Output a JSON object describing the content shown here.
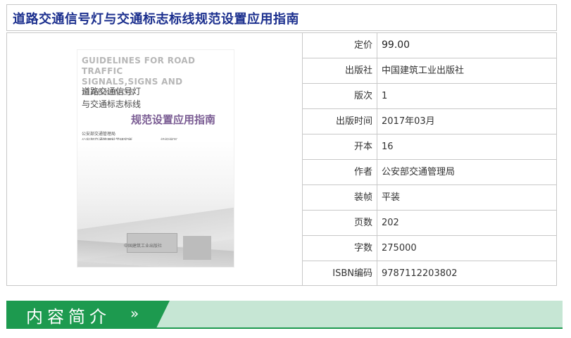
{
  "title": "道路交通信号灯与交通标志标线规范设置应用指南",
  "cover": {
    "en_line1": "GUIDELINES FOR ROAD TRAFFIC",
    "en_line2": "SIGNALS,SIGNS AND MARKINGS",
    "cn_line1": "道路交通信号灯",
    "cn_line2": "与交通标志标线",
    "cn_line3": "规范设置应用指南",
    "pub_line1": "公安部交通管理局",
    "pub_line2": "公安部交通管理科学研究所",
    "pub_line3": "组织编写",
    "foot": "中国建筑工业出版社"
  },
  "details": [
    {
      "label": "定价",
      "value": "99.00"
    },
    {
      "label": "出版社",
      "value": "中国建筑工业出版社"
    },
    {
      "label": "版次",
      "value": "1"
    },
    {
      "label": "出版时间",
      "value": "2017年03月"
    },
    {
      "label": "开本",
      "value": "16"
    },
    {
      "label": "作者",
      "value": "公安部交通管理局"
    },
    {
      "label": "装帧",
      "value": "平装"
    },
    {
      "label": "页数",
      "value": "202"
    },
    {
      "label": "字数",
      "value": "275000"
    },
    {
      "label": "ISBN编码",
      "value": "9787112203802"
    }
  ],
  "section": {
    "label": "内容简介",
    "arrow": "»"
  },
  "colors": {
    "title_text": "#1b2f8e",
    "border": "#c8c8c8",
    "section_green": "#1d9a4f",
    "section_light": "#c6e6d4"
  }
}
